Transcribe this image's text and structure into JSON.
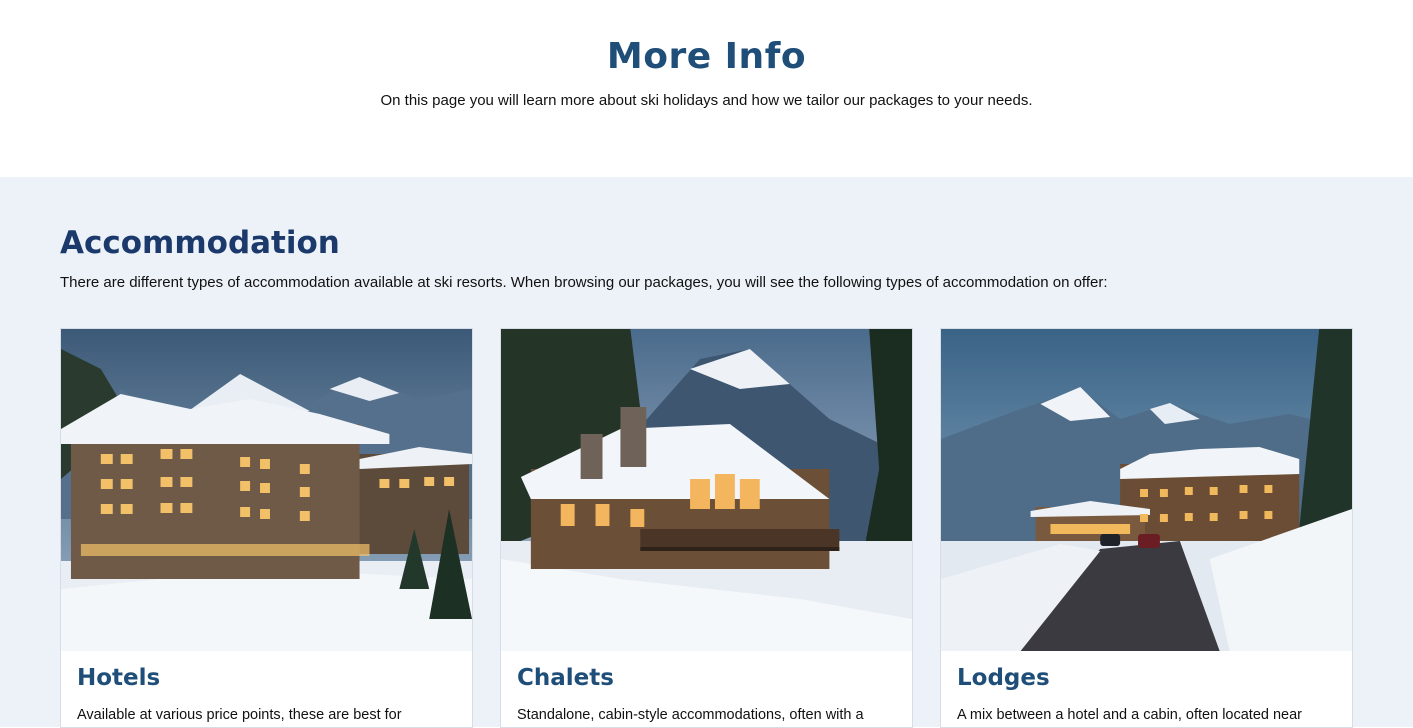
{
  "hero": {
    "title": "More Info",
    "subtitle": "On this page you will learn more about ski holidays and how we tailor our packages to your needs."
  },
  "accommodation": {
    "heading": "Accommodation",
    "intro": "There are different types of accommodation available at ski resorts. When browsing our packages, you will see the following types of accommodation on offer:",
    "cards": [
      {
        "title": "Hotels",
        "text": "Available at various price points, these are best for"
      },
      {
        "title": "Chalets",
        "text": "Standalone, cabin-style accommodations, often with a"
      },
      {
        "title": "Lodges",
        "text": "A mix between a hotel and a cabin, often located near"
      }
    ]
  },
  "colors": {
    "heading": "#1f4e79",
    "section_background": "#edf2f8"
  }
}
